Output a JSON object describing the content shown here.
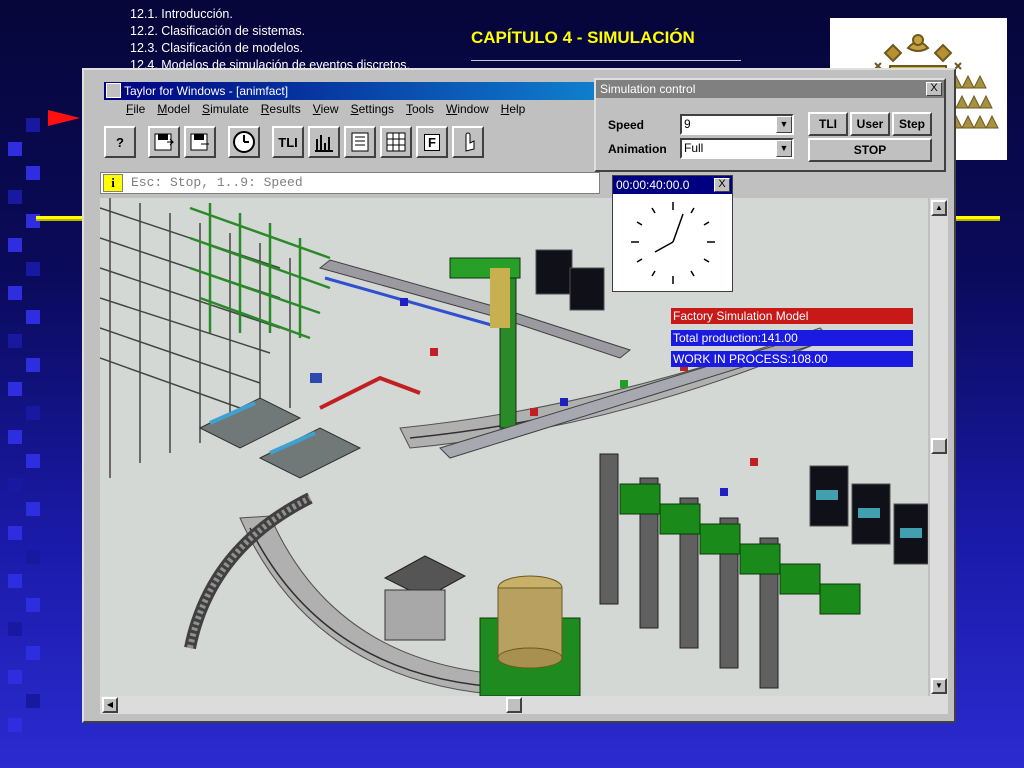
{
  "slide": {
    "toc": [
      "12.1. Introducción.",
      "12.2. Clasificación de sistemas.",
      "12.3. Clasificación de modelos.",
      "12.4. Modelos de simulación de eventos discretos."
    ],
    "chapter_title": "CAPÍTULO 4 - SIMULACIÓN",
    "colors": {
      "accent": "#ffff00",
      "arrow": "#ff1010",
      "background": "#0a0a5a"
    }
  },
  "app": {
    "title": "Taylor for Windows - [animfact]",
    "menu": [
      "File",
      "Model",
      "Simulate",
      "Results",
      "View",
      "Settings",
      "Tools",
      "Window",
      "Help"
    ],
    "toolbar": {
      "help_label": "?",
      "tli_label": "TLI",
      "f_label": "F",
      "icons": [
        "help-icon",
        "save-icon",
        "export-icon",
        "clock-icon",
        "tli-icon",
        "chart-icon",
        "list-icon",
        "grid-icon",
        "form-icon",
        "hand-icon"
      ]
    },
    "status_hint": "Esc: Stop, 1..9: Speed",
    "info_glyph": "i"
  },
  "sim_control": {
    "title": "Simulation control",
    "close_label": "X",
    "speed_label": "Speed",
    "speed_value": "9",
    "animation_label": "Animation",
    "animation_value": "Full",
    "tli_button": "TLI",
    "user_button": "User",
    "step_button": "Step",
    "stop_button": "STOP"
  },
  "clock": {
    "time": "00:00:40:00.0",
    "close_label": "X"
  },
  "model_labels": {
    "title": "Factory Simulation Model",
    "total_production": "Total production:141.00",
    "wip": "WORK IN PROCESS:108.00"
  }
}
